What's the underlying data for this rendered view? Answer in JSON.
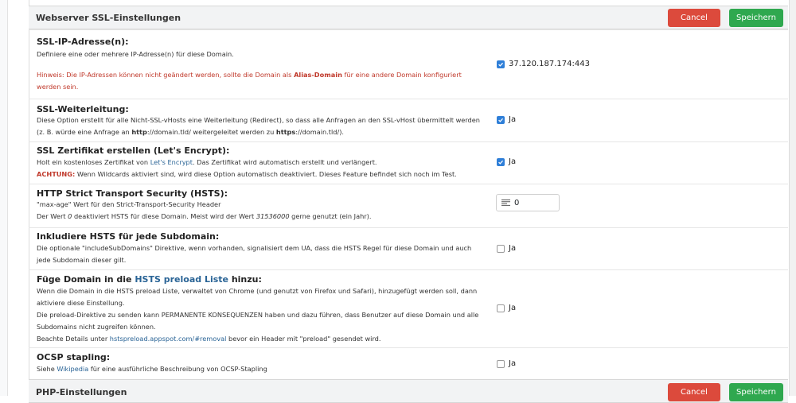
{
  "section_ssl": {
    "title": "Webserver SSL-Einstellungen",
    "cancel_label": "Cancel",
    "save_label": "Speichern"
  },
  "section_php": {
    "title": "PHP-Einstellungen",
    "cancel_label": "Cancel",
    "save_label": "Speichern"
  },
  "rows": {
    "ssl_ip": {
      "label": "SSL-IP-Adresse(n)",
      "suffix": ":",
      "desc": "Definiere eine oder mehrere IP-Adresse(n) für diese Domain.",
      "hint_prefix": "Hinweis: Die IP-Adressen können nicht geändert werden, sollte die Domain als ",
      "hint_bold": "Alias-Domain",
      "hint_suffix": " für eine andere Domain konfiguriert werden sein.",
      "value": "37.120.187.174:443",
      "checked": true
    },
    "ssl_redirect": {
      "label": "SSL-Weiterleitung",
      "suffix": ":",
      "desc_1": "Diese Option erstellt für alle Nicht-SSL-vHosts eine Weiterleitung (Redirect), so dass alle Anfragen an den SSL-vHost übermittelt werden (z. B. würde eine Anfrage an ",
      "desc_b1": "http",
      "desc_2": "://domain.tld/ weitergeleitet werden zu ",
      "desc_b2": "https",
      "desc_3": "://domain.tld/).",
      "value": "Ja",
      "checked": true
    },
    "letsencrypt": {
      "label": "SSL Zertifikat erstellen (Let's Encrypt)",
      "suffix": ":",
      "desc_1": "Holt ein kostenloses Zertifikat von ",
      "desc_link": "Let's Encrypt",
      "desc_2": ". Das Zertifikat wird automatisch erstellt und verlängert.",
      "warn_label": "ACHTUNG:",
      "warn_text": " Wenn Wildcards aktiviert sind, wird diese Option automatisch deaktiviert. Dieses Feature befindet sich noch im Test.",
      "value": "Ja",
      "checked": true
    },
    "hsts": {
      "label": "HTTP Strict Transport Security (HSTS)",
      "suffix": ":",
      "desc_line1": "\"max-age\" Wert für den Strict-Transport-Security Header",
      "desc_2a": "Der Wert ",
      "desc_2i": "0",
      "desc_2b": " deaktiviert HSTS für diese Domain. Meist wird der Wert ",
      "desc_2i2": "31536000",
      "desc_2c": " gerne genutzt (ein Jahr).",
      "value": "0"
    },
    "hsts_sub": {
      "label": "Inkludiere HSTS für jede Subdomain",
      "suffix": ":",
      "desc": "Die optionale \"includeSubDomains\" Direktive, wenn vorhanden, signalisiert dem UA, dass die HSTS Regel für diese Domain und auch jede Subdomain dieser gilt.",
      "value": "Ja",
      "checked": false
    },
    "hsts_preload": {
      "label_1": "Füge Domain in die ",
      "label_link": "HSTS preload Liste",
      "label_2": " hinzu",
      "suffix": ":",
      "desc_1": "Wenn die Domain in die HSTS preload Liste, verwaltet von Chrome (und genutzt von Firefox und Safari), hinzugefügt werden soll, dann aktiviere diese Einstellung.",
      "desc_2": "Die preload-Direktive zu senden kann PERMANENTE KONSEQUENZEN haben und dazu führen, dass Benutzer auf diese Domain und alle Subdomains nicht zugreifen können.",
      "desc_3a": "Beachte Details unter ",
      "desc_3link": "hstspreload.appspot.com/#removal",
      "desc_3b": " bevor ein Header mit \"preload\" gesendet wird.",
      "value": "Ja",
      "checked": false
    },
    "ocsp": {
      "label": "OCSP stapling",
      "suffix": ":",
      "desc_1": "Siehe ",
      "desc_link": "Wikipedia",
      "desc_2": " für eine ausführliche Beschreibung von OCSP-Stapling",
      "value": "Ja",
      "checked": false
    }
  },
  "icons": {
    "checkbox_checked": "check-icon",
    "number_input": "lines-icon"
  },
  "colors": {
    "cancel": "#dc4a3c",
    "save": "#2fa84f",
    "checkbox": "#2f7fd8",
    "warning": "#c0392b",
    "link": "#2a6496"
  }
}
